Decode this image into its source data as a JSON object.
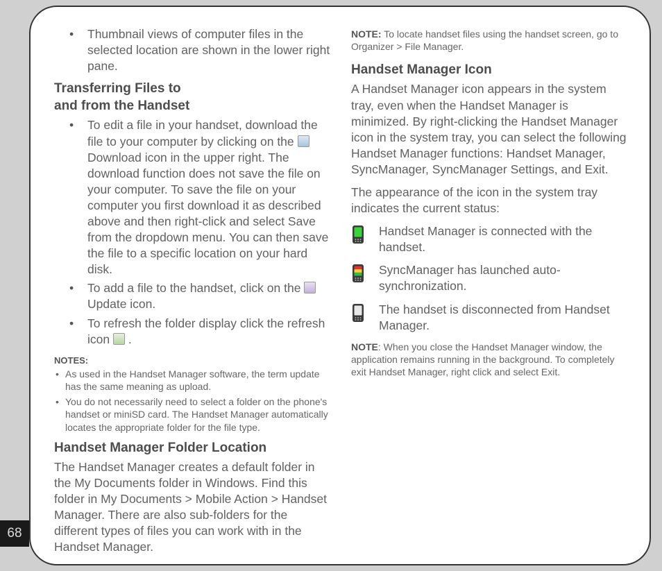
{
  "page_number": "68",
  "left": {
    "intro_bullet": "Thumbnail views of computer files in the selected location are shown in the lower right pane.",
    "heading_transfer_l1": "Transferring Files to",
    "heading_transfer_l2": "and from the Handset",
    "transfer_b1_a": "To edit a file in your handset, download the file to your computer by clicking on the ",
    "transfer_b1_b": " Download icon in the upper right. The download function does not save the file on your computer. To save the file on your computer you first download it as described above and then right-click and select Save from the dropdown menu. You can then save the file to a specific location on your hard disk.",
    "transfer_b2_a": "To add a file to the handset,  click on the ",
    "transfer_b2_b": " Update icon.",
    "transfer_b3_a": "To refresh the folder display click the refresh icon ",
    "transfer_b3_b": ".",
    "notes_label": "NOTES:",
    "note1": "As used in the Handset Manager software, the term update has the same meaning as upload.",
    "note2": "You do not necessarily need to select a folder on the phone's handset or miniSD card. The Handset Manager automatically locates the appropriate folder for the file type.",
    "heading_folder": "Handset Manager Folder Location",
    "folder_para": "The Handset Manager creates a default folder in the My Documents folder in Windows. Find this folder in My Documents > Mobile Action > Handset Manager. There are also sub-folders for the different types of files you can work with in the Handset Manager."
  },
  "right": {
    "top_note_label": "NOTE:",
    "top_note": " To locate handset files using the handset screen, go to Organizer > File Manager.",
    "heading_icon": "Handset Manager Icon",
    "icon_para1": "A Handset Manager icon appears in the system tray, even when the Handset Manager is minimized. By right-clicking  the Handset Manager icon in the system tray, you can select the following Handset Manager functions: Handset Manager, SyncManager, SyncManager Settings, and Exit.",
    "icon_para2": "The appearance of the icon in the system tray indicates the current status:",
    "status": [
      "Handset Manager is connected with the handset.",
      "SyncManager has launched auto-synchronization.",
      "The handset is disconnected from Handset Manager."
    ],
    "bottom_note_label": "NOTE",
    "bottom_note": ": When you close the Handset Manager window, the application remains running in the background. To completely exit Handset Manager, right click and select Exit."
  }
}
